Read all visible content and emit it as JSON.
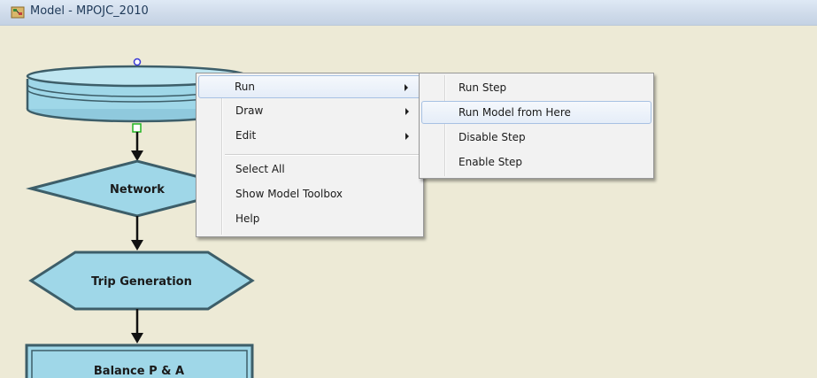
{
  "window": {
    "title": "Model - MPOJC_2010",
    "app_icon": "model-app-icon"
  },
  "flowchart": {
    "nodes": [
      {
        "label": "",
        "shape": "database-cylinder"
      },
      {
        "label": "Network",
        "shape": "diamond"
      },
      {
        "label": "Trip Generation",
        "shape": "hexagon"
      },
      {
        "label": "Balance P & A",
        "shape": "rectangle"
      }
    ],
    "colors": {
      "fill": "#9fd7e8",
      "stroke": "#3d5e69",
      "arrow": "#111111",
      "handle_top": "#3a3ad6",
      "handle_bottom": "#22b422"
    }
  },
  "context_menu": {
    "items": [
      {
        "label": "Run",
        "submenu": true
      },
      {
        "label": "Draw",
        "submenu": true
      },
      {
        "label": "Edit",
        "submenu": true
      },
      {
        "label": "Select All",
        "submenu": false
      },
      {
        "label": "Show Model Toolbox",
        "submenu": false
      },
      {
        "label": "Help",
        "submenu": false
      }
    ]
  },
  "run_submenu": {
    "items": [
      {
        "label": "Run Step"
      },
      {
        "label": "Run Model from Here",
        "highlighted": true
      },
      {
        "label": "Disable Step"
      },
      {
        "label": "Enable Step"
      }
    ]
  },
  "colors": {
    "background": "#edead6",
    "menu_bg": "#f2f2f2",
    "highlight": "#e5edf8"
  }
}
